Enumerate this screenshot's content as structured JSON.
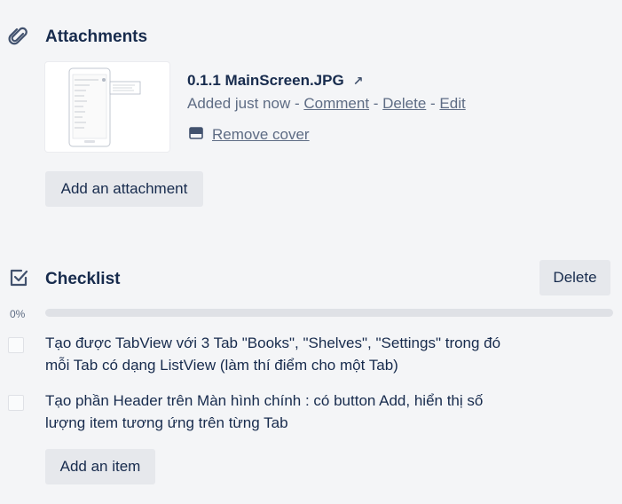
{
  "attachments": {
    "title": "Attachments",
    "icon": "paperclip-icon",
    "item": {
      "name": "0.1.1 MainScreen.JPG",
      "arrow": "↗",
      "added": "Added just now",
      "sep": " - ",
      "comment": "Comment",
      "delete": "Delete",
      "edit": "Edit",
      "remove_cover": "Remove cover"
    },
    "add_button": "Add an attachment"
  },
  "checklist": {
    "title": "Checklist",
    "icon": "checkbox-icon",
    "delete_button": "Delete",
    "progress_label": "0%",
    "progress": 0,
    "items": [
      {
        "text": "Tạo được TabView với 3 Tab \"Books\", \"Shelves\", \"Settings\" trong đó mỗi Tab có dạng ListView (làm thí điểm cho một Tab)",
        "checked": false
      },
      {
        "text": "Tạo phần Header trên Màn hình chính : có button Add, hiển thị số lượng item tương ứng trên từng Tab",
        "checked": false
      }
    ],
    "add_item_button": "Add an item"
  },
  "colors": {
    "background": "#f4f5f7",
    "text": "#172b4d",
    "muted": "#5e6c84",
    "button": "#e6e8ec"
  }
}
